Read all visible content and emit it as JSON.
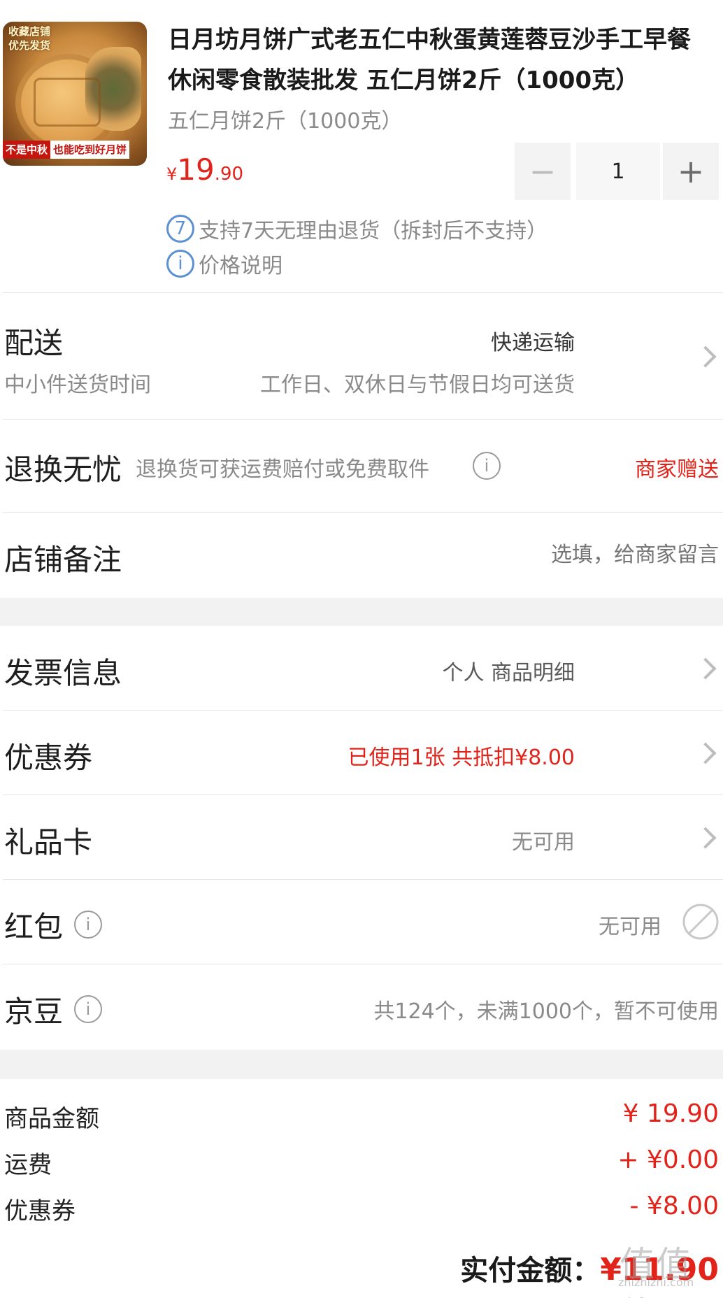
{
  "product": {
    "image_tag_top_line1": "收藏店铺",
    "image_tag_top_line2": "优先发货",
    "image_tag_bottom_red": "不是中秋",
    "image_tag_bottom_white": "也能吃到好月饼",
    "title": "日月坊月饼广式老五仁中秋蛋黄莲蓉豆沙手工早餐休闲零食散装批发 五仁月饼2斤（1000克）",
    "spec": "五仁月饼2斤（1000克）",
    "price_symbol": "¥",
    "price_integer": "19",
    "price_decimal": ".90",
    "quantity": "1",
    "minus_label": "−",
    "plus_label": "+",
    "return_badge": "7",
    "return_policy": "支持7天无理由退货（拆封后不支持）",
    "price_info_icon": "i",
    "price_info": "价格说明"
  },
  "delivery": {
    "label": "配送",
    "method": "快递运输",
    "sub_label": "中小件送货时间",
    "sub_value": "工作日、双休日与节假日均可送货"
  },
  "return_worry_free": {
    "label": "退换无忧",
    "desc": "退换货可获运费赔付或免费取件",
    "info_icon": "i",
    "value": "商家赠送"
  },
  "store_note": {
    "label": "店铺备注",
    "placeholder": "选填，给商家留言"
  },
  "invoice": {
    "label": "发票信息",
    "value": "个人 商品明细"
  },
  "coupon": {
    "label": "优惠券",
    "value": "已使用1张 共抵扣¥8.00"
  },
  "gift_card": {
    "label": "礼品卡",
    "value": "无可用"
  },
  "red_packet": {
    "label": "红包",
    "info_icon": "i",
    "value": "无可用"
  },
  "jd_beans": {
    "label": "京豆",
    "info_icon": "i",
    "value": "共124个，未满1000个，暂不可使用"
  },
  "summary": {
    "goods_label": "商品金额",
    "goods_value": "¥ 19.90",
    "shipping_label": "运费",
    "shipping_value": "+ ¥0.00",
    "coupon_label": "优惠券",
    "coupon_value": "- ¥8.00",
    "total_label": "实付金额：",
    "total_value": "¥11.90"
  },
  "watermark": {
    "line1": "值值值",
    "line2": "zhizhizhi.com"
  },
  "colors": {
    "accent_red": "#e2231a",
    "info_blue": "#5b91d3",
    "muted_gray": "#8a8a8a",
    "divider": "#e6e6e6",
    "section_gap": "#f2f2f2"
  },
  "icons": {
    "return_badge": "seven-day-return-icon",
    "price_info": "info-icon",
    "chevron": "chevron-right-icon",
    "disabled": "disabled-circle-icon"
  }
}
